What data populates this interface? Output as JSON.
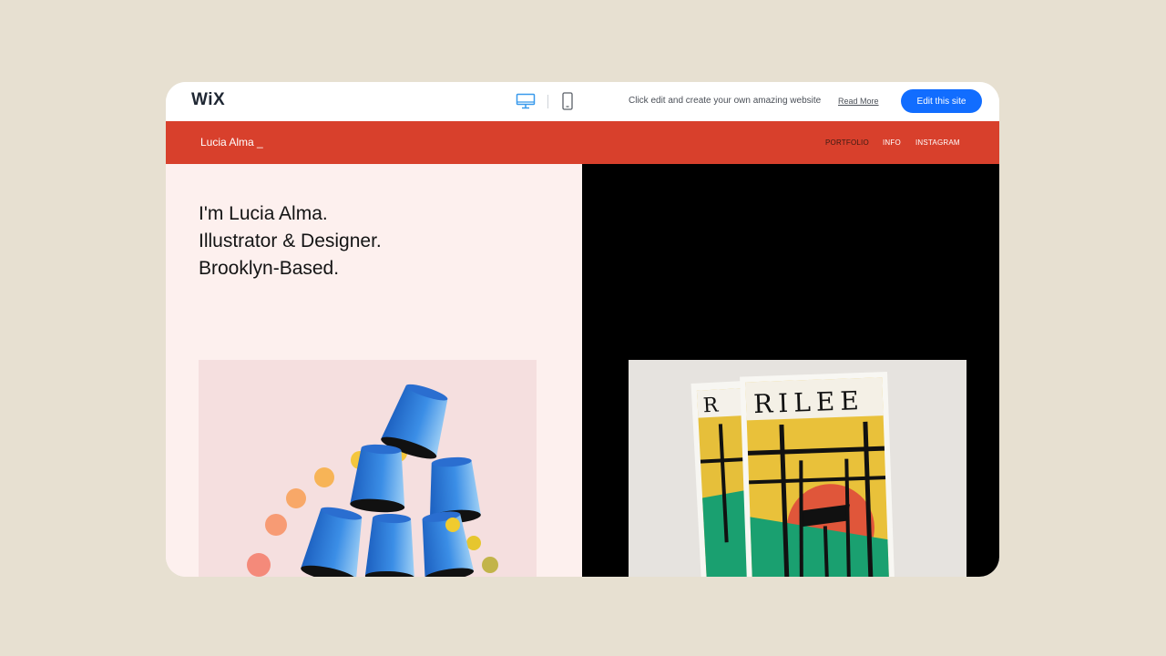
{
  "wix_bar": {
    "logo": "WiX",
    "promo_text": "Click edit and create your own amazing website",
    "read_more": "Read More",
    "edit_button": "Edit this site",
    "icons": [
      "desktop-icon",
      "mobile-icon"
    ]
  },
  "site": {
    "name": "Lucia Alma _",
    "nav": [
      "PORTFOLIO",
      "INFO",
      "INSTAGRAM"
    ],
    "hero_lines": [
      "I'm Lucia Alma.",
      "Illustrator & Designer.",
      "Brooklyn-Based."
    ]
  },
  "artwork": {
    "book_title": "RILEE",
    "back_book_letter": "R"
  },
  "colors": {
    "background": "#e7e0d1",
    "header_red": "#d8402c",
    "accent_blue": "#116dff",
    "left_panel": "#fdf0ee",
    "right_panel": "#000000"
  }
}
